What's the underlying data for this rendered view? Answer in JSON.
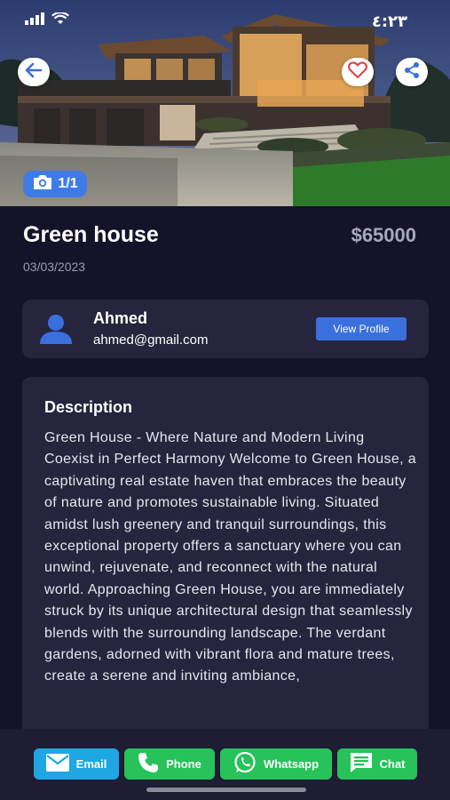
{
  "status_bar": {
    "time": "٤:٢٣"
  },
  "hero": {
    "photo_counter": "1/1"
  },
  "listing": {
    "title": "Green house",
    "price": "$65000",
    "date": "03/03/2023"
  },
  "owner": {
    "name": "Ahmed",
    "email": "ahmed@gmail.com",
    "view_profile_label": "View Profile"
  },
  "description": {
    "heading": "Description",
    "body": "Green House - Where Nature and Modern Living Coexist in Perfect Harmony Welcome to Green House, a captivating real estate haven that embraces the beauty of nature and promotes sustainable living. Situated amidst lush greenery and tranquil surroundings, this exceptional property offers a sanctuary where you can unwind, rejuvenate, and reconnect with the natural world. Approaching Green House, you are immediately struck by its unique architectural design that seamlessly blends with the surrounding landscape. The verdant gardens, adorned with vibrant flora and mature trees, create a serene and inviting ambiance,"
  },
  "actions": {
    "email_label": "Email",
    "phone_label": "Phone",
    "whatsapp_label": "Whatsapp",
    "chat_label": "Chat"
  },
  "icons": {
    "back": "arrow-left-icon",
    "favorite": "heart-icon",
    "share": "share-icon",
    "camera": "camera-icon",
    "avatar": "person-icon",
    "email": "envelope-icon",
    "phone": "phone-icon",
    "whatsapp": "whatsapp-icon",
    "chat": "chat-bubble-icon"
  },
  "colors": {
    "background": "#14132a",
    "card": "#26253d",
    "accent_blue": "#3a6fde",
    "email_blue": "#1ea7e2",
    "green": "#27c25a",
    "heart_red": "#e0454e"
  }
}
